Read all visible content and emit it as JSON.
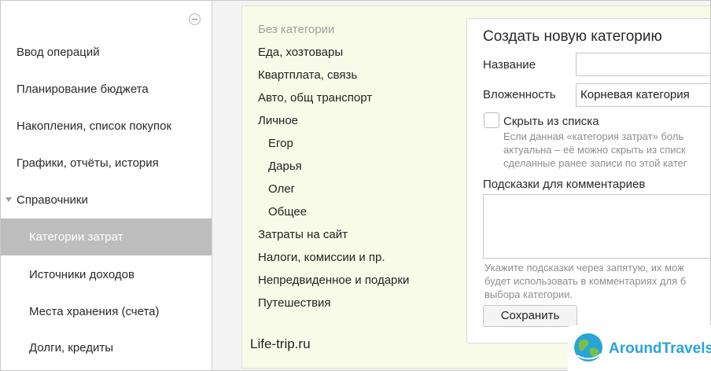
{
  "sidebar": {
    "items": [
      {
        "label": "Ввод операций"
      },
      {
        "label": "Планирование бюджета"
      },
      {
        "label": "Накопления, список покупок"
      },
      {
        "label": "Графики, отчёты, история"
      },
      {
        "label": "Справочники"
      },
      {
        "label": "Категории затрат"
      },
      {
        "label": "Источники доходов"
      },
      {
        "label": "Места хранения (счета)"
      },
      {
        "label": "Долги, кредиты"
      }
    ]
  },
  "categories": [
    "Без категории",
    "Еда, хозтовары",
    "Квартплата, связь",
    "Авто, общ транспорт",
    "Личное",
    "Егор",
    "Дарья",
    "Олег",
    "Общее",
    "Затраты на сайт",
    "Налоги, комиссии и пр.",
    "Непредвиденное и подарки",
    "Путешествия"
  ],
  "watermark": "Life-trip.ru",
  "form": {
    "title": "Создать новую категорию",
    "name_label": "Название",
    "name_value": "",
    "parent_label": "Вложенность",
    "parent_value": "Корневая категория",
    "hide_label": "Скрыть из списка",
    "hide_hint": [
      "Если данная «категория затрат» боль",
      "актуальна – её можно скрыть из списк",
      "сделанные ранее записи по этой катег"
    ],
    "hints_label": "Подсказки для комментариев",
    "hints_value": "",
    "hints_hint": [
      "Укажите подсказки через запятую, их мож",
      "будет использовать в комментариях для б",
      "выбора категории."
    ],
    "save_label": "Сохранить"
  },
  "logo": {
    "text": "AroundTravels"
  }
}
